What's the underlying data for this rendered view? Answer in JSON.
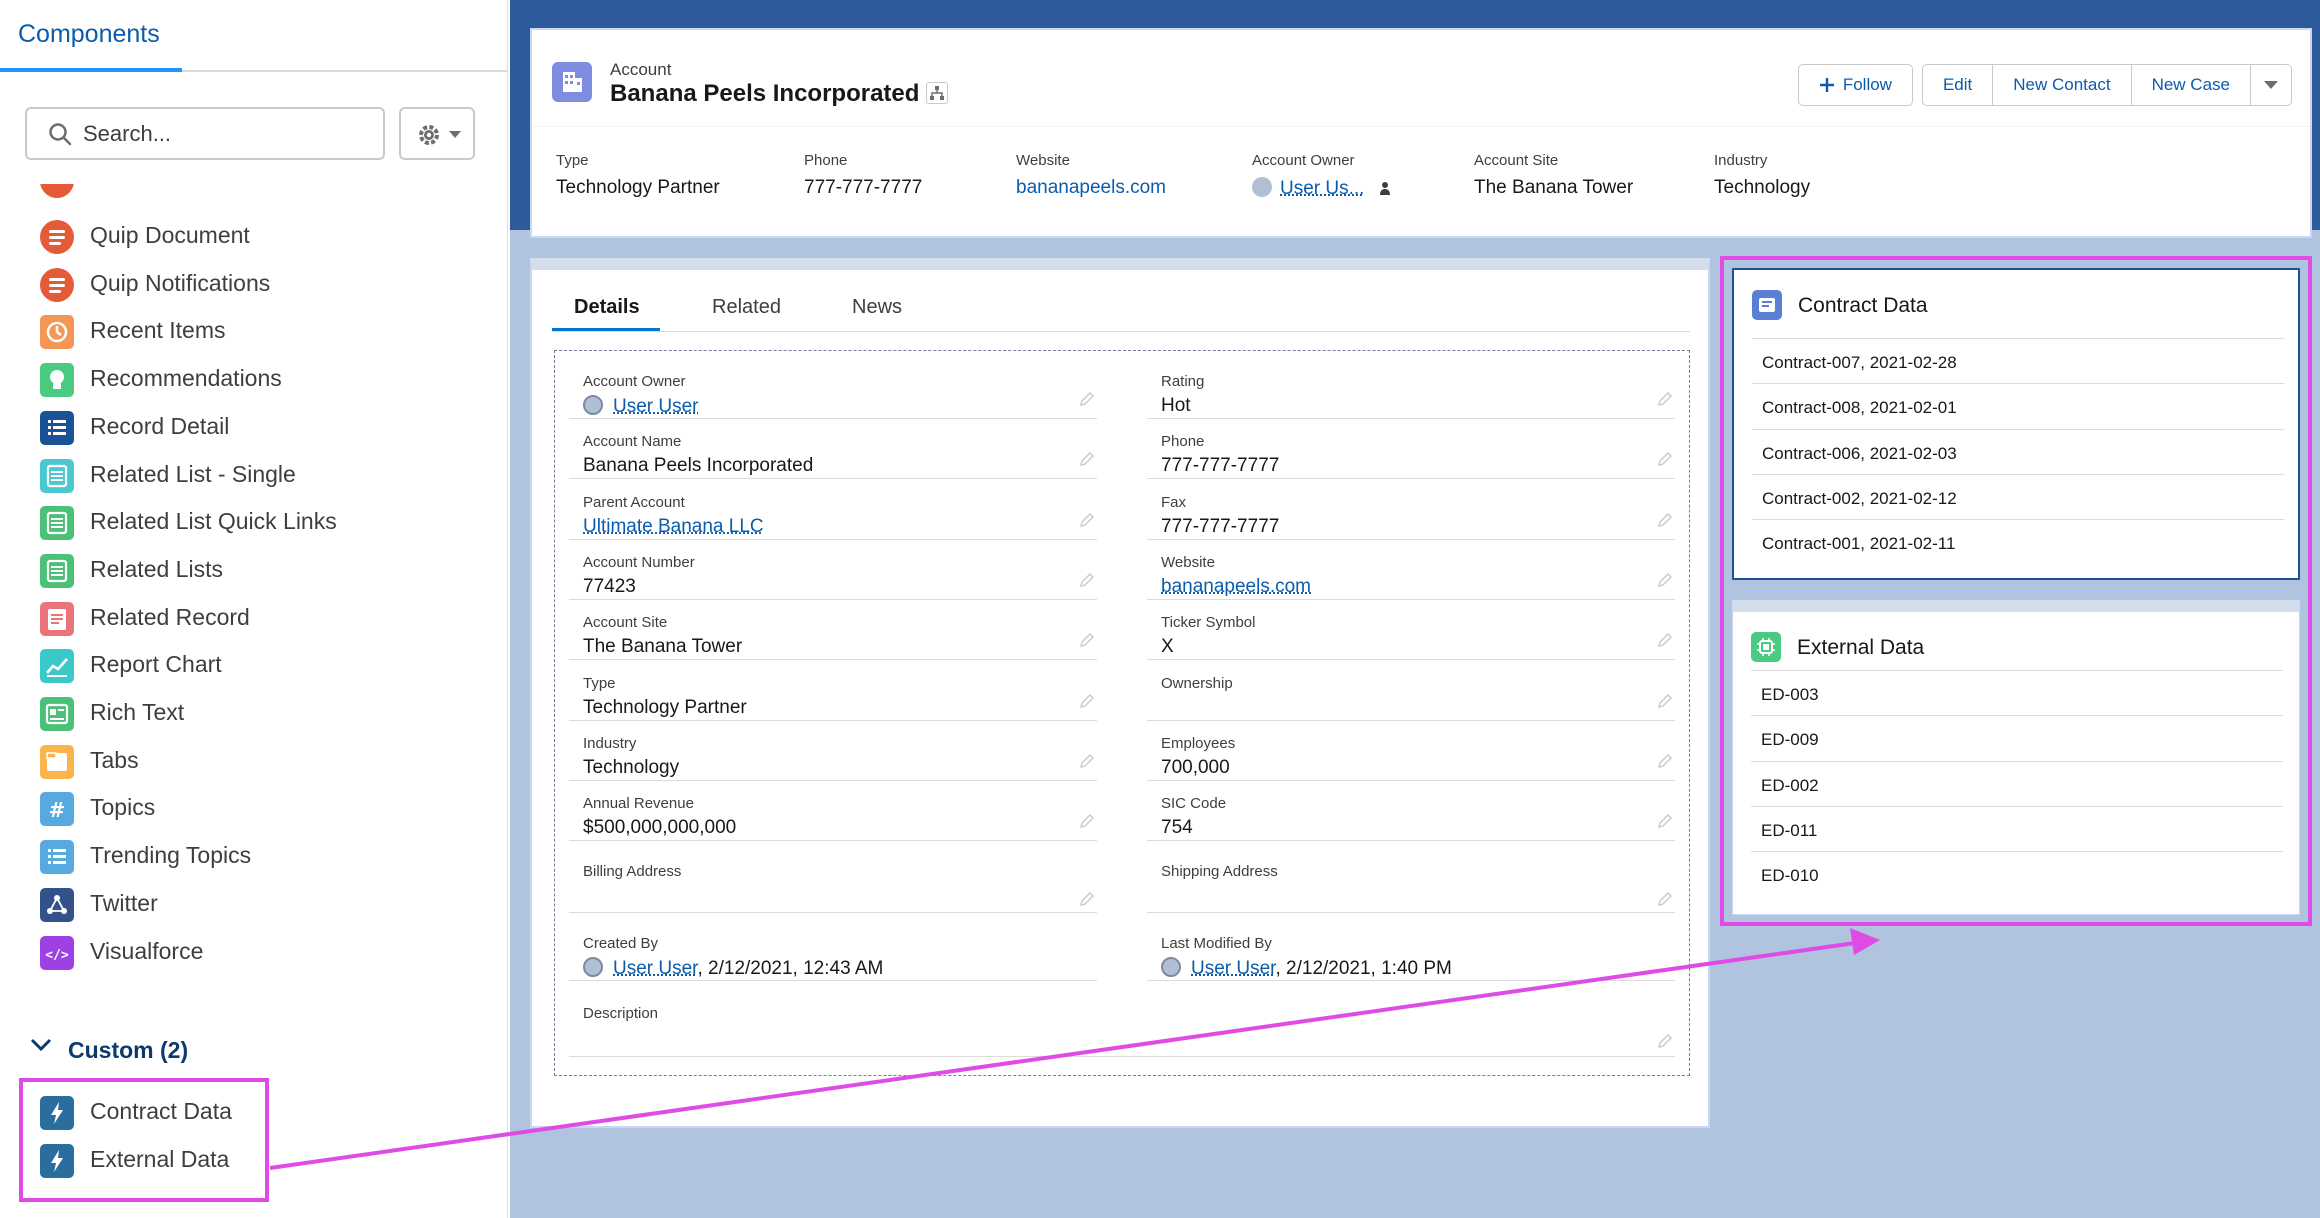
{
  "left_panel": {
    "tab": "Components",
    "search_placeholder": "Search...",
    "items": [
      {
        "label": "Quip Document",
        "icon": "quip-icon",
        "color": "#e55a37"
      },
      {
        "label": "Quip Notifications",
        "icon": "quip-icon",
        "color": "#e55a37"
      },
      {
        "label": "Recent Items",
        "icon": "clock-icon",
        "color": "#f49756"
      },
      {
        "label": "Recommendations",
        "icon": "lightbulb-icon",
        "color": "#4bca81"
      },
      {
        "label": "Record Detail",
        "icon": "list-icon",
        "color": "#1b5297"
      },
      {
        "label": "Related List - Single",
        "icon": "related-list-icon",
        "color": "#4bc7d0"
      },
      {
        "label": "Related List Quick Links",
        "icon": "related-list-icon",
        "color": "#4bc076"
      },
      {
        "label": "Related Lists",
        "icon": "related-list-icon",
        "color": "#4bc076"
      },
      {
        "label": "Related Record",
        "icon": "record-icon",
        "color": "#ea7479"
      },
      {
        "label": "Report Chart",
        "icon": "chart-icon",
        "color": "#3bc8c8"
      },
      {
        "label": "Rich Text",
        "icon": "richtext-icon",
        "color": "#4bc076"
      },
      {
        "label": "Tabs",
        "icon": "tabs-icon",
        "color": "#f9b54a"
      },
      {
        "label": "Topics",
        "icon": "hash-icon",
        "color": "#56aadf"
      },
      {
        "label": "Trending Topics",
        "icon": "list-icon",
        "color": "#56aadf"
      },
      {
        "label": "Twitter",
        "icon": "twitter-icon",
        "color": "#34528a"
      },
      {
        "label": "Visualforce",
        "icon": "code-icon",
        "color": "#9e41e4"
      }
    ],
    "custom_header": "Custom (2)",
    "custom_items": [
      {
        "label": "Contract Data",
        "icon": "lightning-icon",
        "color": "#2a6d9e"
      },
      {
        "label": "External Data",
        "icon": "lightning-icon",
        "color": "#2a6d9e"
      }
    ]
  },
  "highlights": {
    "object": "Account",
    "title": "Banana Peels Incorporated",
    "actions": {
      "follow": "Follow",
      "edit": "Edit",
      "new_contact": "New Contact",
      "new_case": "New Case"
    },
    "fields": [
      {
        "label": "Type",
        "value": "Technology Partner"
      },
      {
        "label": "Phone",
        "value": "777-777-7777"
      },
      {
        "label": "Website",
        "value": "bananapeels.com"
      },
      {
        "label": "Account Owner",
        "value": "User Us..."
      },
      {
        "label": "Account Site",
        "value": "The Banana Tower"
      },
      {
        "label": "Industry",
        "value": "Technology"
      }
    ]
  },
  "details": {
    "tabs": [
      "Details",
      "Related",
      "News"
    ],
    "left_fields": [
      {
        "label": "Account Owner",
        "value": "User User"
      },
      {
        "label": "Account Name",
        "value": "Banana Peels Incorporated"
      },
      {
        "label": "Parent Account",
        "value": "Ultimate Banana LLC"
      },
      {
        "label": "Account Number",
        "value": "77423"
      },
      {
        "label": "Account Site",
        "value": "The Banana Tower"
      },
      {
        "label": "Type",
        "value": "Technology Partner"
      },
      {
        "label": "Industry",
        "value": "Technology"
      },
      {
        "label": "Annual Revenue",
        "value": "$500,000,000,000"
      }
    ],
    "right_fields": [
      {
        "label": "Rating",
        "value": "Hot"
      },
      {
        "label": "Phone",
        "value": "777-777-7777"
      },
      {
        "label": "Fax",
        "value": "777-777-7777"
      },
      {
        "label": "Website",
        "value": "bananapeels.com"
      },
      {
        "label": "Ticker Symbol",
        "value": "X"
      },
      {
        "label": "Ownership",
        "value": ""
      },
      {
        "label": "Employees",
        "value": "700,000"
      },
      {
        "label": "SIC Code",
        "value": "754"
      }
    ],
    "billing_label": "Billing Address",
    "shipping_label": "Shipping Address",
    "created_by": {
      "label": "Created By",
      "user": "User User",
      "date": ", 2/12/2021, 12:43 AM"
    },
    "modified_by": {
      "label": "Last Modified By",
      "user": "User User",
      "date": ", 2/12/2021, 1:40 PM"
    },
    "description_label": "Description"
  },
  "contract_card": {
    "title": "Contract Data",
    "rows": [
      "Contract-007, 2021-02-28",
      "Contract-008, 2021-02-01",
      "Contract-006, 2021-02-03",
      "Contract-002, 2021-02-12",
      "Contract-001, 2021-02-11"
    ]
  },
  "external_card": {
    "title": "External Data",
    "rows": [
      "ED-003",
      "ED-009",
      "ED-002",
      "ED-011",
      "ED-010"
    ]
  },
  "colors": {
    "highlight_annotation": "#e04be6",
    "link": "#0b5cab",
    "canvas": "#b0c4df"
  }
}
